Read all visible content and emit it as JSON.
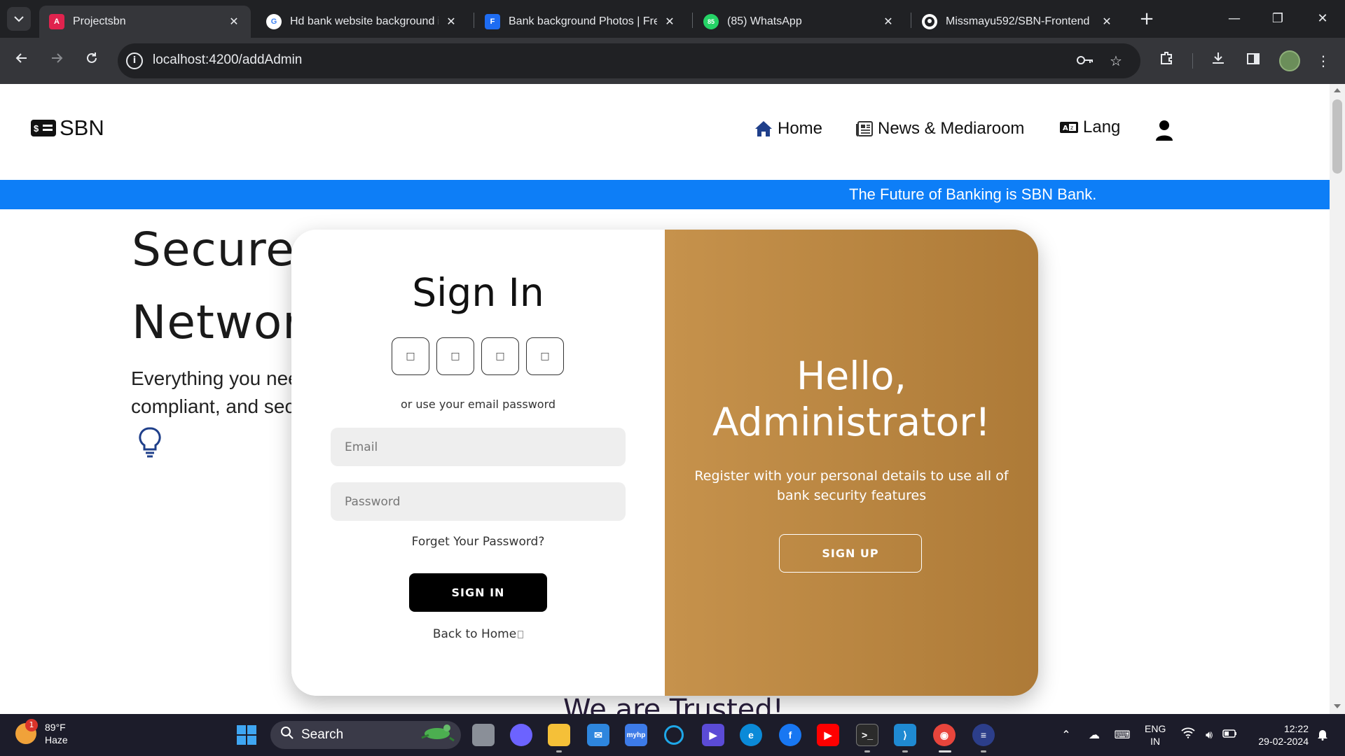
{
  "browser": {
    "tabs": [
      {
        "title": "Projectsbn",
        "active": true,
        "icon": "angular-icon",
        "color": "#e0234e"
      },
      {
        "title": "Hd bank website background in",
        "active": false,
        "icon": "google-icon",
        "color": "#ffffff"
      },
      {
        "title": "Bank background Photos | Free",
        "active": false,
        "icon": "freepik-icon",
        "color": "#1e6cf2"
      },
      {
        "title": "(85) WhatsApp",
        "active": false,
        "icon": "whatsapp-icon",
        "color": "#25d366",
        "badge": "85"
      },
      {
        "title": "Missmayu592/SBN-Frontend",
        "active": false,
        "icon": "github-icon",
        "color": "#ffffff"
      }
    ],
    "url": "localhost:4200/addAdmin"
  },
  "site": {
    "brand": "SBN",
    "brand_icon": "$",
    "nav": {
      "home": "Home",
      "news": "News & Mediaroom",
      "lang": "Lang"
    },
    "ticker": "The Future of Banking is SBN Bank.",
    "hero": {
      "title_line1": "Secure B",
      "title_line2": "Networ",
      "sub_line1": "Everything you nee",
      "sub_line2": "compliant, and sec"
    },
    "trusted": "We are Trusted!"
  },
  "modal": {
    "signin_title": "Sign In",
    "social_buttons": [
      "□",
      "□",
      "□",
      "□"
    ],
    "or_text": "or use your email password",
    "email_placeholder": "Email",
    "password_placeholder": "Password",
    "forgot": "Forget Your Password?",
    "signin_button": "SIGN IN",
    "back_home": "Back to Home",
    "hello_title": "Hello, Administrator!",
    "hello_sub": "Register with your personal details to use all of bank security features",
    "signup_button": "SIGN UP",
    "accent_color": "#b8843f"
  },
  "taskbar": {
    "weather_temp": "89°F",
    "weather_desc": "Haze",
    "weather_badge": "1",
    "search_label": "Search",
    "lang_line1": "ENG",
    "lang_line2": "IN",
    "time": "12:22",
    "date": "29-02-2024"
  }
}
